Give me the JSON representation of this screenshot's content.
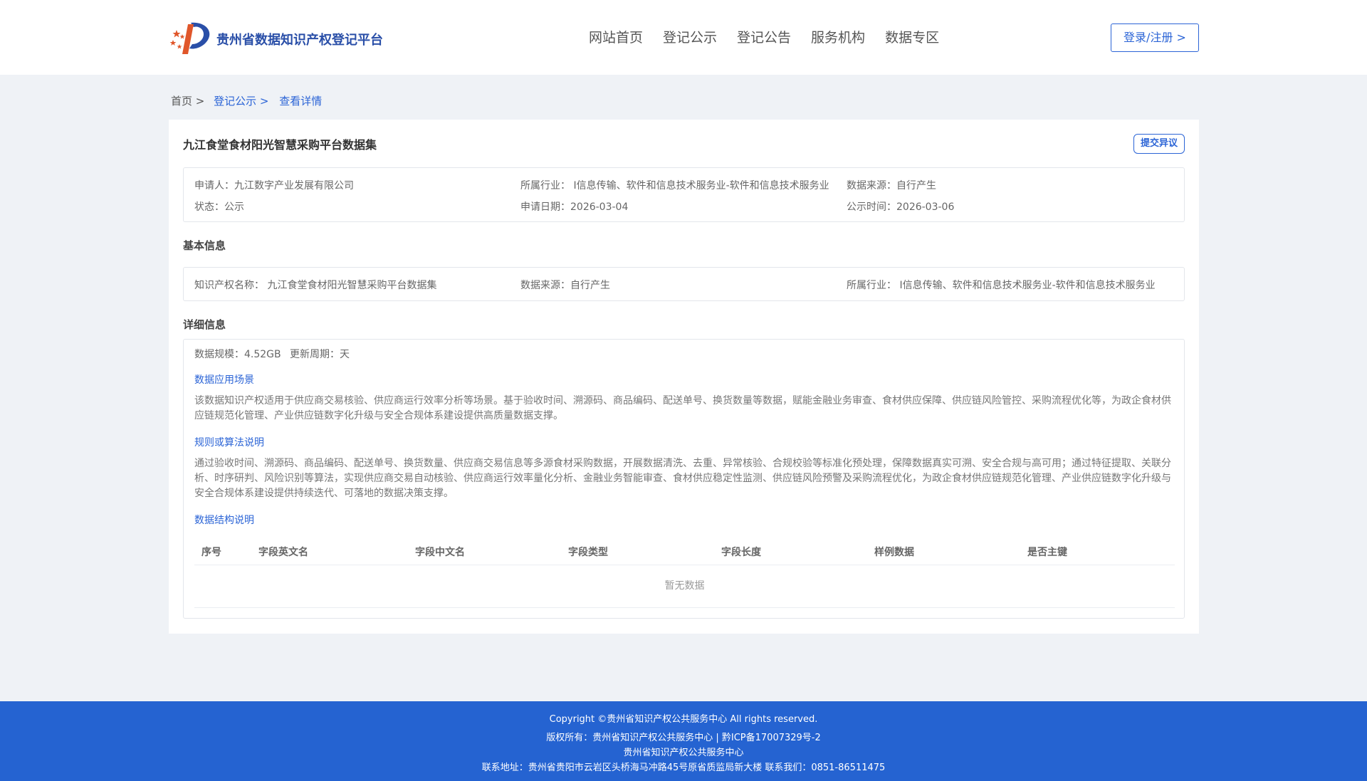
{
  "header": {
    "site_title": "贵州省数据知识产权登记平台",
    "nav": [
      "网站首页",
      "登记公示",
      "登记公告",
      "服务机构",
      "数据专区"
    ],
    "login_label": "登录/注册 >"
  },
  "breadcrumb": {
    "home": "首页 >",
    "list": "登记公示 >",
    "current": "查看详情"
  },
  "detail": {
    "title": "九江食堂食材阳光智慧采购平台数据集",
    "objection_label": "提交异议",
    "summary": {
      "applicant": "申请人：九江数字产业发展有限公司",
      "industry": "所属行业： I信息传输、软件和信息技术服务业-软件和信息技术服务业",
      "source": "数据来源：自行产生",
      "status": "状态：公示",
      "apply_date": "申请日期：2026-03-04",
      "publish_date": "公示时间：2026-03-06"
    },
    "basic": {
      "section_title": "基本信息",
      "ip_name": "知识产权名称： 九江食堂食材阳光智慧采购平台数据集",
      "source": "数据来源：自行产生",
      "industry": "所属行业： I信息传输、软件和信息技术服务业-软件和信息技术服务业"
    },
    "details": {
      "section_title": "详细信息",
      "scale": "数据规模：4.52GB",
      "update_cycle": "更新周期：天",
      "scenario_title": "数据应用场景",
      "scenario_text": "该数据知识产权适用于供应商交易核验、供应商运行效率分析等场景。基于验收时间、溯源码、商品编码、配送单号、换货数量等数据，赋能金融业务审查、食材供应保障、供应链风险管控、采购流程优化等，为政企食材供应链规范化管理、产业供应链数字化升级与安全合规体系建设提供高质量数据支撑。",
      "algorithm_title": "规则或算法说明",
      "algorithm_text": "通过验收时间、溯源码、商品编码、配送单号、换货数量、供应商交易信息等多源食材采购数据，开展数据清洗、去重、异常核验、合规校验等标准化预处理，保障数据真实可溯、安全合规与高可用；通过特征提取、关联分析、时序研判、风险识别等算法，实现供应商交易自动核验、供应商运行效率量化分析、金融业务智能审查、食材供应稳定性监测、供应链风险预警及采购流程优化，为政企食材供应链规范化管理、产业供应链数字化升级与安全合规体系建设提供持续迭代、可落地的数据决策支撑。",
      "structure_title": "数据结构说明",
      "table_headers": [
        "序号",
        "字段英文名",
        "字段中文名",
        "字段类型",
        "字段长度",
        "样例数据",
        "是否主键"
      ],
      "empty_text": "暂无数据"
    }
  },
  "footer": {
    "copyright": "Copyright ©贵州省知识产权公共服务中心 All rights reserved.",
    "rights": "版权所有：贵州省知识产权公共服务中心 | 黔ICP备17007329号-2",
    "org": "贵州省知识产权公共服务中心",
    "contact": "联系地址：贵州省贵阳市云岩区头桥海马冲路45号原省质监局新大楼 联系我们：0851-86511475"
  }
}
